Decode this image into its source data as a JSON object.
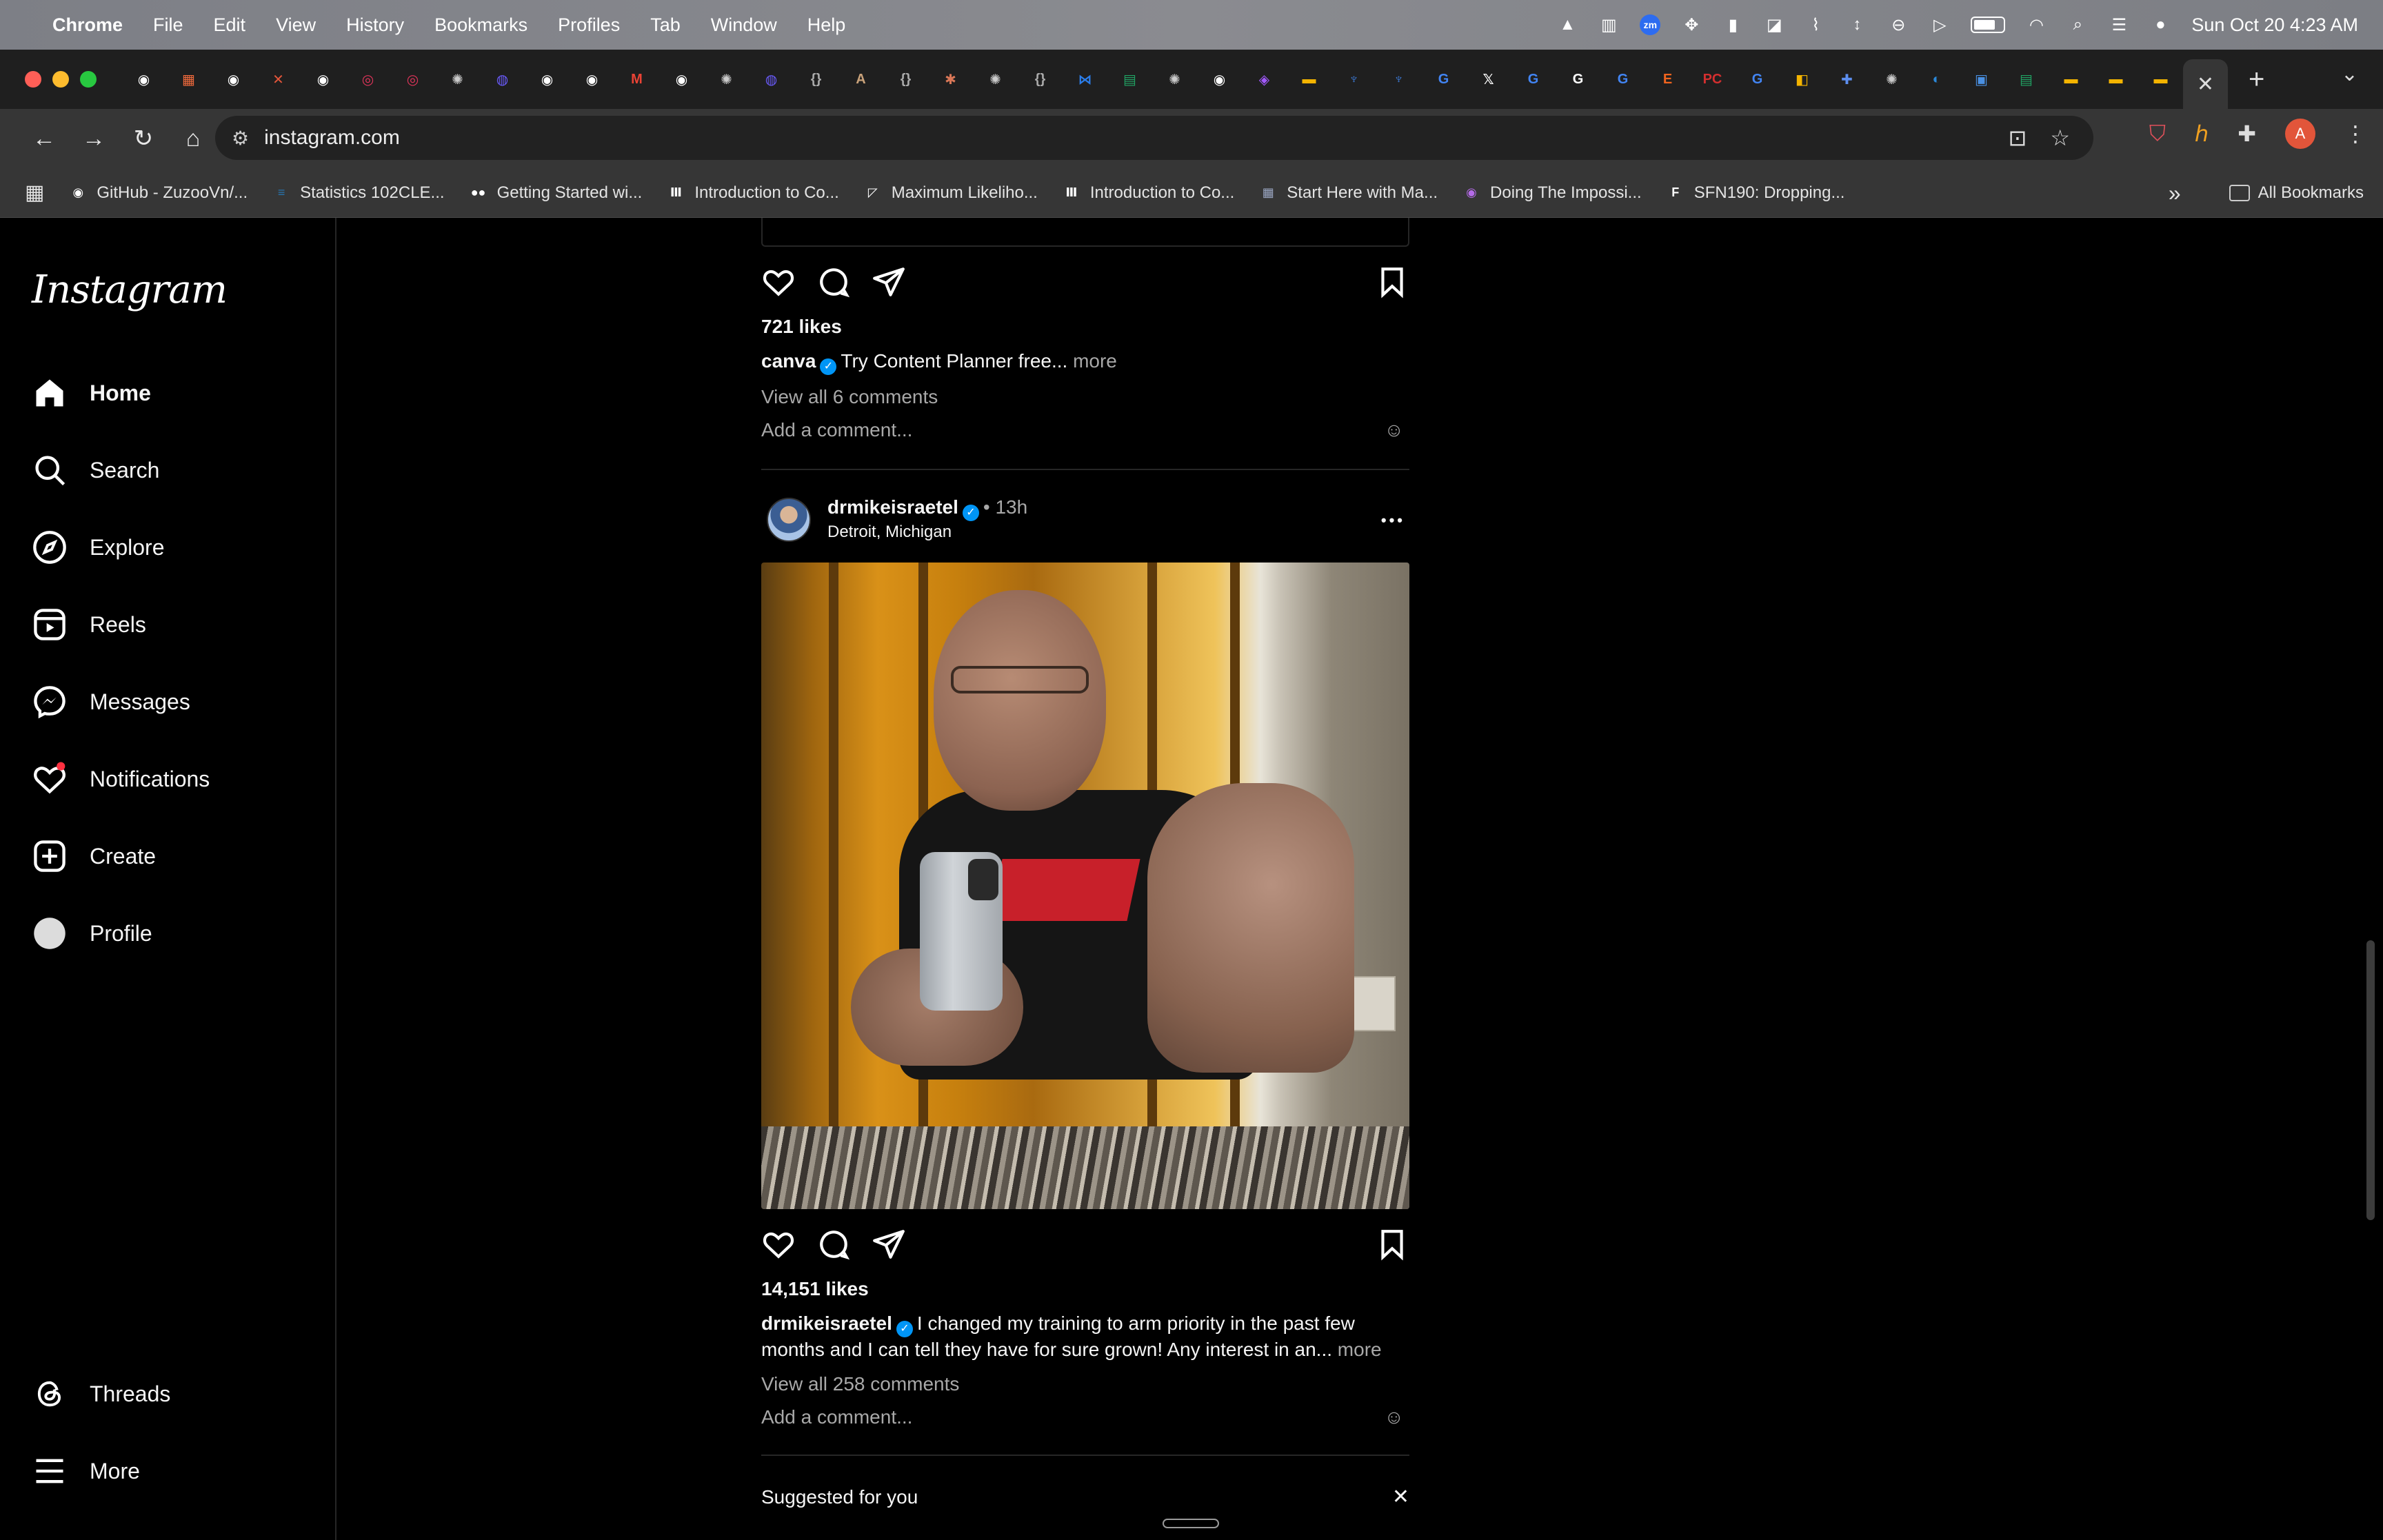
{
  "menubar": {
    "app_name": "Chrome",
    "items": [
      "File",
      "Edit",
      "View",
      "History",
      "Bookmarks",
      "Profiles",
      "Tab",
      "Window",
      "Help"
    ],
    "clock": "Sun Oct 20  4:23 AM",
    "zoom_label": "zm"
  },
  "tabs": {
    "favicons": [
      {
        "icon": "github-icon",
        "color": "#ffffff",
        "glyph": "◉"
      },
      {
        "icon": "orange-grid-icon",
        "color": "#f06a3c",
        "glyph": "▦"
      },
      {
        "icon": "github-icon",
        "color": "#ffffff",
        "glyph": "◉"
      },
      {
        "icon": "x-red-icon",
        "color": "#e2553a",
        "glyph": "✕"
      },
      {
        "icon": "github-icon",
        "color": "#ffffff",
        "glyph": "◉"
      },
      {
        "icon": "spiral-red-icon",
        "color": "#e0345a",
        "glyph": "◎"
      },
      {
        "icon": "spiral-red-icon",
        "color": "#e0345a",
        "glyph": "◎"
      },
      {
        "icon": "openai-icon",
        "color": "#cccccc",
        "glyph": "✺"
      },
      {
        "icon": "purple-app-icon",
        "color": "#6b5cff",
        "glyph": "◍"
      },
      {
        "icon": "github-icon",
        "color": "#ffffff",
        "glyph": "◉"
      },
      {
        "icon": "github-icon",
        "color": "#ffffff",
        "glyph": "◉"
      },
      {
        "icon": "gmail-icon",
        "color": "#ea4335",
        "glyph": "M"
      },
      {
        "icon": "github-icon",
        "color": "#ffffff",
        "glyph": "◉"
      },
      {
        "icon": "openai-icon",
        "color": "#cccccc",
        "glyph": "✺"
      },
      {
        "icon": "purple-app-icon",
        "color": "#6b5cff",
        "glyph": "◍"
      },
      {
        "icon": "brackets-icon",
        "color": "#aaaaaa",
        "glyph": "{}"
      },
      {
        "icon": "anthropic-icon",
        "color": "#c9a27a",
        "glyph": "A"
      },
      {
        "icon": "brackets-icon",
        "color": "#aaaaaa",
        "glyph": "{}"
      },
      {
        "icon": "claude-icon",
        "color": "#d97757",
        "glyph": "✱"
      },
      {
        "icon": "openai-icon",
        "color": "#cccccc",
        "glyph": "✺"
      },
      {
        "icon": "brackets-icon",
        "color": "#aaaaaa",
        "glyph": "{}"
      },
      {
        "icon": "vscode-icon",
        "color": "#2b7de9",
        "glyph": "⋈"
      },
      {
        "icon": "sheets-icon",
        "color": "#21a464",
        "glyph": "▤"
      },
      {
        "icon": "openai-icon",
        "color": "#cccccc",
        "glyph": "✺"
      },
      {
        "icon": "github-icon",
        "color": "#ffffff",
        "glyph": "◉"
      },
      {
        "icon": "figma-icon",
        "color": "#a259ff",
        "glyph": "◈"
      },
      {
        "icon": "slides-icon",
        "color": "#f4b400",
        "glyph": "▬"
      },
      {
        "icon": "blue-app-icon",
        "color": "#3d7bd9",
        "glyph": "♆"
      },
      {
        "icon": "blue-app-icon",
        "color": "#3d7bd9",
        "glyph": "♆"
      },
      {
        "icon": "google-icon",
        "color": "#4285f4",
        "glyph": "G"
      },
      {
        "icon": "x-icon",
        "color": "#ffffff",
        "glyph": "𝕏"
      },
      {
        "icon": "google-icon",
        "color": "#4285f4",
        "glyph": "G"
      },
      {
        "icon": "g-black-icon",
        "color": "#ffffff",
        "glyph": "G"
      },
      {
        "icon": "google-icon",
        "color": "#4285f4",
        "glyph": "G"
      },
      {
        "icon": "etsy-icon",
        "color": "#f1641e",
        "glyph": "E"
      },
      {
        "icon": "pc-icon",
        "color": "#d32f2f",
        "glyph": "PC"
      },
      {
        "icon": "google-icon",
        "color": "#4285f4",
        "glyph": "G"
      },
      {
        "icon": "canvas-icon",
        "color": "#f4b400",
        "glyph": "◧"
      },
      {
        "icon": "puzzle-blue-icon",
        "color": "#5d8ff0",
        "glyph": "✚"
      },
      {
        "icon": "openai-icon",
        "color": "#cccccc",
        "glyph": "✺"
      },
      {
        "icon": "edge-icon",
        "color": "#2b88d8",
        "glyph": "◐"
      },
      {
        "icon": "photos-icon",
        "color": "#4a90e2",
        "glyph": "▣"
      },
      {
        "icon": "sheets-icon",
        "color": "#21a464",
        "glyph": "▤"
      },
      {
        "icon": "slides-icon",
        "color": "#f4b400",
        "glyph": "▬"
      },
      {
        "icon": "slides-icon",
        "color": "#f4b400",
        "glyph": "▬"
      },
      {
        "icon": "slides-icon",
        "color": "#f4b400",
        "glyph": "▬"
      }
    ],
    "active_close": "✕",
    "new_tab": "+",
    "tab_search": "⌄"
  },
  "toolbar": {
    "url": "instagram.com",
    "back": "←",
    "forward": "→",
    "reload": "↻",
    "home": "⌂",
    "profile_initial": "A"
  },
  "bookmarks": {
    "items": [
      {
        "label": "GitHub - ZuzooVn/...",
        "icon": "github-icon",
        "color": "#ffffff",
        "glyph": "◉"
      },
      {
        "label": "Statistics 102CLE...",
        "icon": "ucla-icon",
        "color": "#2774ae",
        "glyph": "≡"
      },
      {
        "label": "Getting Started wi...",
        "icon": "medium-icon",
        "color": "#ffffff",
        "glyph": "●●"
      },
      {
        "label": "Introduction to Co...",
        "icon": "coursera-icon",
        "color": "#ffffff",
        "glyph": "Ⅲ"
      },
      {
        "label": "Maximum Likeliho...",
        "icon": "chart-icon",
        "color": "#ffffff",
        "glyph": "◸"
      },
      {
        "label": "Introduction to Co...",
        "icon": "coursera-icon",
        "color": "#ffffff",
        "glyph": "Ⅲ"
      },
      {
        "label": "Start Here with Ma...",
        "icon": "image-thumb-icon",
        "color": "#9aa6c2",
        "glyph": "▦"
      },
      {
        "label": "Doing The Impossi...",
        "icon": "podcast-icon",
        "color": "#b56be8",
        "glyph": "◉"
      },
      {
        "label": "SFN190: Dropping...",
        "icon": "f-icon",
        "color": "#ffffff",
        "glyph": "F"
      }
    ],
    "overflow": "»",
    "all_bookmarks": "All Bookmarks"
  },
  "instagram": {
    "logo": "Instagram",
    "nav": [
      {
        "label": "Home",
        "icon": "home-icon",
        "active": true
      },
      {
        "label": "Search",
        "icon": "search-icon"
      },
      {
        "label": "Explore",
        "icon": "compass-icon"
      },
      {
        "label": "Reels",
        "icon": "reels-icon"
      },
      {
        "label": "Messages",
        "icon": "messenger-icon"
      },
      {
        "label": "Notifications",
        "icon": "heart-icon",
        "badge": true
      },
      {
        "label": "Create",
        "icon": "plus-square-icon"
      },
      {
        "label": "Profile",
        "icon": "profile-avatar-icon"
      }
    ],
    "nav_bottom": [
      {
        "label": "Threads",
        "icon": "threads-icon"
      },
      {
        "label": "More",
        "icon": "hamburger-icon"
      }
    ],
    "previous_post": {
      "likes": "721 likes",
      "username": "canva",
      "caption": "Try Content Planner free...",
      "more": "more",
      "view_comments": "View all 6 comments",
      "add_comment": "Add a comment..."
    },
    "post": {
      "username": "drmikeisraetel",
      "time": "13h",
      "separator": "•",
      "location": "Detroit, Michigan",
      "options": "•••",
      "likes": "14,151 likes",
      "caption": "I changed my training to arm priority in the past few months and I can tell they have for sure grown! Any interest in an...",
      "more": "more",
      "view_comments": "View all 258 comments",
      "add_comment": "Add a comment..."
    },
    "suggested_title": "Suggested for you",
    "suggested_close": "✕"
  }
}
